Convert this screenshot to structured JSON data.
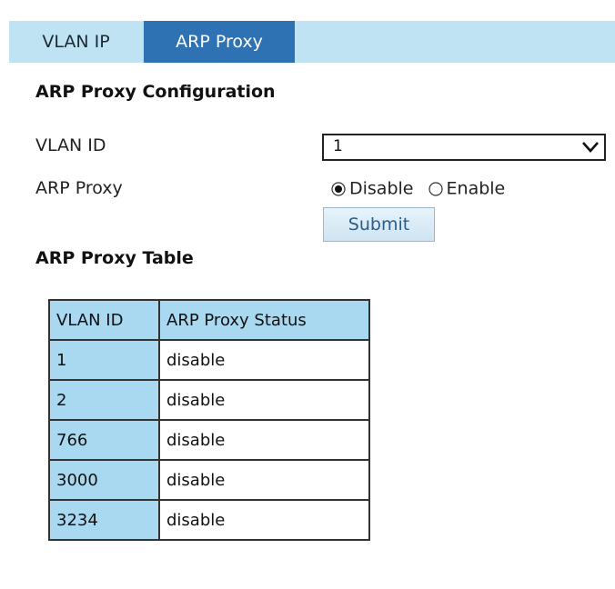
{
  "tabs": [
    {
      "label": "VLAN IP",
      "active": false
    },
    {
      "label": "ARP Proxy",
      "active": true
    }
  ],
  "config": {
    "title": "ARP Proxy Configuration",
    "vlan_id_label": "VLAN ID",
    "vlan_id_value": "1",
    "arp_proxy_label": "ARP Proxy",
    "radio_options": [
      "Disable",
      "Enable"
    ],
    "radio_selected": "Disable",
    "submit_label": "Submit"
  },
  "table": {
    "title": "ARP Proxy Table",
    "headers": [
      "VLAN ID",
      "ARP Proxy Status"
    ],
    "rows": [
      [
        "1",
        "disable"
      ],
      [
        "2",
        "disable"
      ],
      [
        "766",
        "disable"
      ],
      [
        "3000",
        "disable"
      ],
      [
        "3234",
        "disable"
      ]
    ]
  },
  "colors": {
    "tabbar_bg": "#bfe3f3",
    "active_tab_bg": "#2e72b3",
    "table_header_bg": "#a9d9f1",
    "submit_text": "#2c5d86"
  },
  "icons": {
    "dropdown": "chevron-down-icon",
    "radio_on": "radio-checked-icon",
    "radio_off": "radio-unchecked-icon"
  }
}
